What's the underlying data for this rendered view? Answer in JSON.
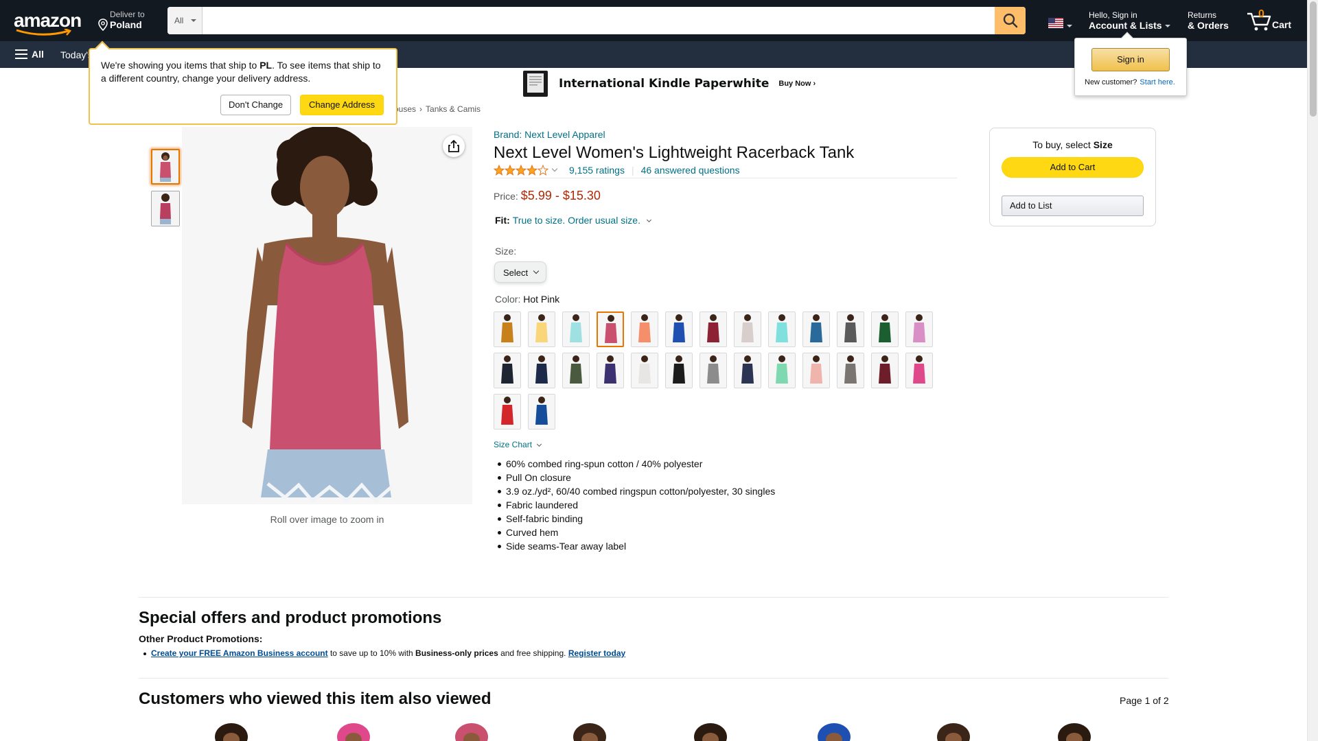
{
  "header": {
    "logo": "amazon",
    "deliver_line1": "Deliver to",
    "deliver_line2": "Poland",
    "search_category": "All",
    "search_placeholder": "",
    "account_line1": "Hello, Sign in",
    "account_line2": "Account & Lists",
    "returns_line1": "Returns",
    "returns_line2": "& Orders",
    "cart_count": "0",
    "cart_label": "Cart"
  },
  "subnav": {
    "all_label": "All",
    "today_label": "Today's"
  },
  "kindle_banner": {
    "title": "International Kindle Paperwhite",
    "cta": "Buy Now"
  },
  "breadcrumb": [
    "ouses",
    "Tanks & Camis"
  ],
  "ship_popover": {
    "text_before": "We're showing you items that ship to ",
    "country": "PL",
    "text_after": ". To see items that ship to a different country, change your delivery address.",
    "dont_change": "Don't Change",
    "change_address": "Change Address"
  },
  "signin_flyout": {
    "button": "Sign in",
    "new_customer": "New customer?",
    "start_here": "Start here."
  },
  "product": {
    "brand": "Brand: Next Level Apparel",
    "title": "Next Level Women's Lightweight Racerback Tank",
    "rating_stars": 4.0,
    "ratings": "9,155 ratings",
    "answered": "46 answered questions",
    "price_label": "Price:",
    "price": "$5.99 - $15.30",
    "fit_label": "Fit:",
    "fit_text": "True to size. Order usual size.",
    "size_label": "Size:",
    "size_select": "Select",
    "color_label": "Color:",
    "color_value": "Hot Pink",
    "zoom_hint": "Roll over image to zoom in",
    "size_chart": "Size Chart",
    "bullets": [
      "60% combed ring-spun cotton / 40% polyester",
      "Pull On closure",
      "3.9 oz./yd², 60/40 combed ringspun cotton/polyester, 30 singles",
      "Fabric laundered",
      "Self-fabric binding",
      "Curved hem",
      "Side seams-Tear away label"
    ],
    "swatch_colors": [
      "#c8801b",
      "#f9d67a",
      "#9fe0e3",
      "#c9506e",
      "#f58e6b",
      "#1f4fb0",
      "#8c2233",
      "#d8cfcc",
      "#7fe0de",
      "#2a6a9b",
      "#5a5a5a",
      "#1b5e2f",
      "#d98fc6",
      "#1f2433",
      "#1d2a4a",
      "#4a5a3e",
      "#3b3070",
      "#e8e6e4",
      "#1c1c1c",
      "#8c8c8c",
      "#2b3452",
      "#7fd9b0",
      "#efb4ab",
      "#7b7572",
      "#6e1e2b",
      "#e0488c",
      "#d2262b",
      "#154d9b"
    ],
    "selected_swatch": 3
  },
  "buybox": {
    "title_prefix": "To buy, select ",
    "title_bold": "Size",
    "add_to_cart": "Add to Cart",
    "add_to_list": "Add to List"
  },
  "offers": {
    "title": "Special offers and product promotions",
    "subtitle": "Other Product Promotions:",
    "link1": "Create your FREE Amazon Business account",
    "text1": " to save up to 10% with ",
    "bold1": "Business-only prices",
    "text2": " and free shipping. ",
    "link2": "Register today"
  },
  "customers_viewed": {
    "title": "Customers who viewed this item also viewed",
    "page": "Page 1 of 2"
  }
}
